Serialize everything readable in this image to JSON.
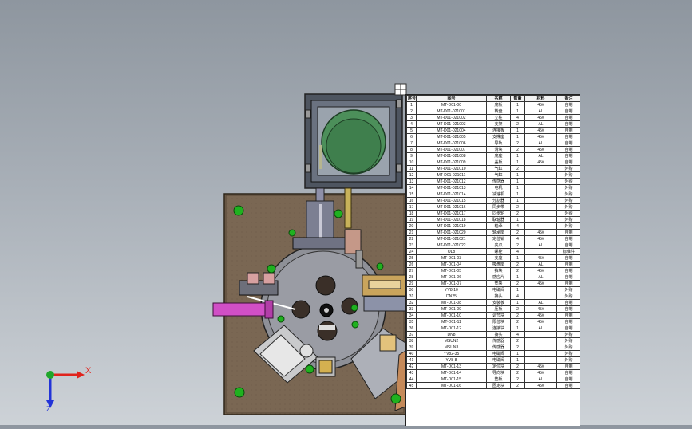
{
  "viewport": {
    "name": "cad-graphics-area",
    "background": "#a9b0b8"
  },
  "triad": {
    "x_label": "X",
    "z_label": "Z",
    "x_color": "#e0231c",
    "y_color": "#1fa62a",
    "z_color": "#2233d8"
  },
  "bom": {
    "headers": [
      "序号",
      "图号",
      "名称",
      "数量",
      "材料",
      "备注"
    ],
    "rows": [
      [
        "1",
        "MT-D01-00",
        "底板",
        "1",
        "45#",
        "自制"
      ],
      [
        "2",
        "MT-D01-021001",
        "转盘",
        "1",
        "AL",
        "自制"
      ],
      [
        "3",
        "MT-D01-021002",
        "立柱",
        "4",
        "45#",
        "自制"
      ],
      [
        "4",
        "MT-D01-021003",
        "支架",
        "2",
        "AL",
        "自制"
      ],
      [
        "5",
        "MT-D01-021004",
        "连接板",
        "1",
        "45#",
        "自制"
      ],
      [
        "6",
        "MT-D01-021005",
        "支撑座",
        "1",
        "45#",
        "自制"
      ],
      [
        "7",
        "MT-D01-021006",
        "导轨",
        "2",
        "AL",
        "自制"
      ],
      [
        "8",
        "MT-D01-021007",
        "滑块",
        "2",
        "45#",
        "自制"
      ],
      [
        "9",
        "MT-D01-021008",
        "底座",
        "1",
        "AL",
        "自制"
      ],
      [
        "10",
        "MT-D01-021009",
        "盖板",
        "1",
        "45#",
        "自制"
      ],
      [
        "11",
        "MT-D01-021010",
        "气缸",
        "2",
        "",
        "外购"
      ],
      [
        "12",
        "MT-D01-021011",
        "气缸",
        "1",
        "",
        "外购"
      ],
      [
        "13",
        "MT-D01-021012",
        "传感器",
        "1",
        "",
        "外购"
      ],
      [
        "14",
        "MT-D01-021013",
        "电机",
        "1",
        "",
        "外购"
      ],
      [
        "15",
        "MT-D01-021014",
        "减速机",
        "1",
        "",
        "外购"
      ],
      [
        "16",
        "MT-D01-021015",
        "分割器",
        "1",
        "",
        "外购"
      ],
      [
        "17",
        "MT-D01-021016",
        "同步带",
        "2",
        "",
        "外购"
      ],
      [
        "18",
        "MT-D01-021017",
        "同步轮",
        "2",
        "",
        "外购"
      ],
      [
        "19",
        "MT-D01-021018",
        "联轴器",
        "1",
        "",
        "外购"
      ],
      [
        "20",
        "MT-D01-021019",
        "轴承",
        "4",
        "",
        "外购"
      ],
      [
        "21",
        "MT-D01-021020",
        "轴承座",
        "2",
        "45#",
        "自制"
      ],
      [
        "22",
        "MT-D01-021021",
        "定位销",
        "4",
        "45#",
        "自制"
      ],
      [
        "23",
        "MT-D01-021022",
        "夹爪",
        "2",
        "AL",
        "自制"
      ],
      [
        "24",
        "OL8",
        "螺栓",
        "4",
        "",
        "标准件"
      ],
      [
        "25",
        "MT-D01-03",
        "支座",
        "1",
        "45#",
        "自制"
      ],
      [
        "26",
        "MT-D01-04",
        "吸盘座",
        "2",
        "AL",
        "自制"
      ],
      [
        "27",
        "MT-D01-05",
        "挡块",
        "2",
        "45#",
        "自制"
      ],
      [
        "28",
        "MT-D01-06",
        "感应片",
        "1",
        "AL",
        "自制"
      ],
      [
        "29",
        "MT-D01-07",
        "垫块",
        "2",
        "45#",
        "自制"
      ],
      [
        "30",
        "YV8-10",
        "电磁阀",
        "1",
        "",
        "外购"
      ],
      [
        "31",
        "DN25",
        "接头",
        "4",
        "",
        "外购"
      ],
      [
        "32",
        "MT-D01-08",
        "安装板",
        "1",
        "AL",
        "自制"
      ],
      [
        "33",
        "MT-D01-09",
        "压板",
        "2",
        "45#",
        "自制"
      ],
      [
        "34",
        "MT-D01-10",
        "调节块",
        "2",
        "45#",
        "自制"
      ],
      [
        "35",
        "MT-D01-11",
        "限位块",
        "2",
        "45#",
        "自制"
      ],
      [
        "36",
        "MT-D01-12",
        "连接块",
        "1",
        "AL",
        "自制"
      ],
      [
        "37",
        "DN8",
        "接头",
        "4",
        "",
        "外购"
      ],
      [
        "38",
        "MSUN2",
        "传感器",
        "2",
        "",
        "外购"
      ],
      [
        "39",
        "MSUN3",
        "传感器",
        "2",
        "",
        "外购"
      ],
      [
        "40",
        "YV82-35",
        "电磁阀",
        "1",
        "",
        "外购"
      ],
      [
        "41",
        "YV8-8",
        "电磁阀",
        "1",
        "",
        "外购"
      ],
      [
        "42",
        "MT-D01-13",
        "定位块",
        "2",
        "45#",
        "自制"
      ],
      [
        "43",
        "MT-D01-14",
        "导向块",
        "2",
        "45#",
        "自制"
      ],
      [
        "44",
        "MT-D01-15",
        "垫板",
        "2",
        "AL",
        "自制"
      ],
      [
        "45",
        "MT-D01-16",
        "固定块",
        "2",
        "45#",
        "自制"
      ]
    ]
  }
}
